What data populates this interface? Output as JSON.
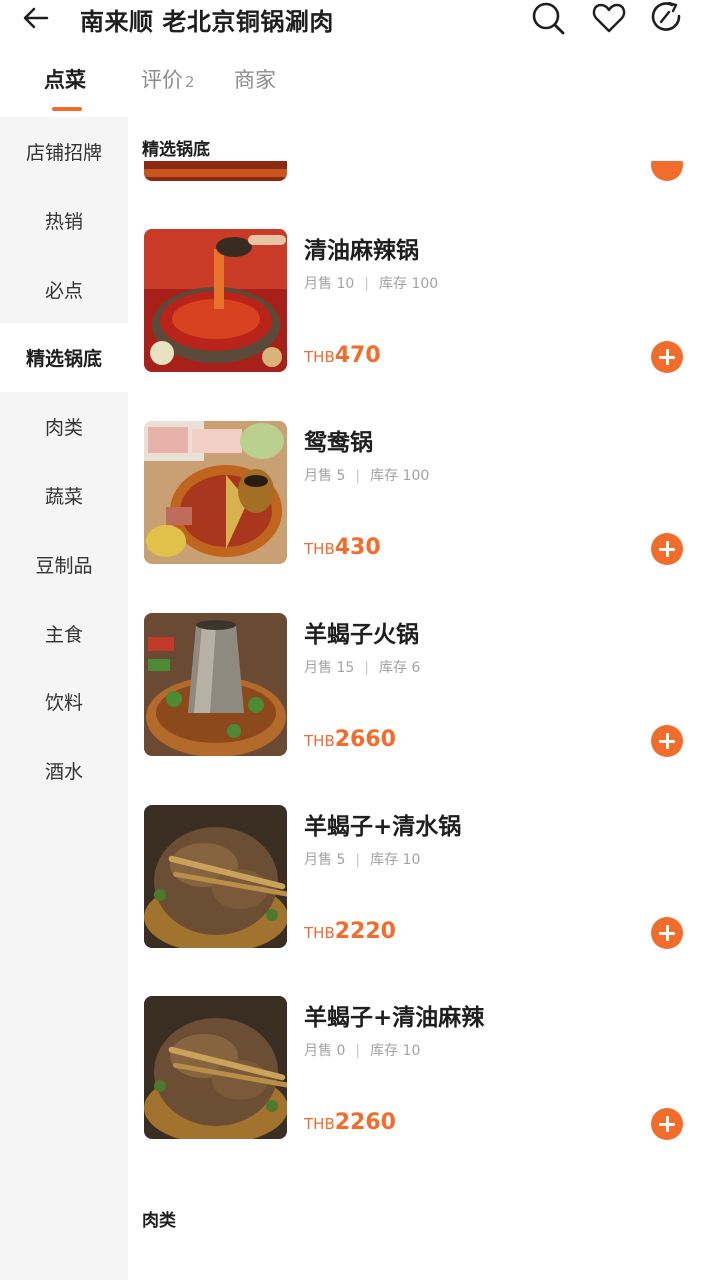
{
  "header": {
    "title": "南来顺 老北京铜锅涮肉",
    "icons": [
      "back-arrow-icon",
      "search-icon",
      "heart-icon",
      "share-icon"
    ]
  },
  "tabs": {
    "menu": "点菜",
    "reviews": "评价",
    "reviews_count": "2",
    "merchant": "商家"
  },
  "sidebar": {
    "items": [
      {
        "label": "店铺招牌"
      },
      {
        "label": "热销"
      },
      {
        "label": "必点"
      },
      {
        "label": "精选锅底"
      },
      {
        "label": "肉类"
      },
      {
        "label": "蔬菜"
      },
      {
        "label": "豆制品"
      },
      {
        "label": "主食"
      },
      {
        "label": "饮料"
      },
      {
        "label": "酒水"
      }
    ],
    "active_index": 3
  },
  "content": {
    "section_title": "精选锅底",
    "next_section_title": "肉类",
    "products": [
      {
        "name": "清油麻辣锅",
        "sales_label": "月售",
        "sales": "10",
        "stock_label": "库存",
        "stock": "100",
        "currency": "THB",
        "price": "470"
      },
      {
        "name": "鸳鸯锅",
        "sales_label": "月售",
        "sales": "5",
        "stock_label": "库存",
        "stock": "100",
        "currency": "THB",
        "price": "430"
      },
      {
        "name": "羊蝎子火锅",
        "sales_label": "月售",
        "sales": "15",
        "stock_label": "库存",
        "stock": "6",
        "currency": "THB",
        "price": "2660"
      },
      {
        "name": "羊蝎子+清水锅",
        "sales_label": "月售",
        "sales": "5",
        "stock_label": "库存",
        "stock": "10",
        "currency": "THB",
        "price": "2220"
      },
      {
        "name": "羊蝎子+清油麻辣",
        "sales_label": "月售",
        "sales": "0",
        "stock_label": "库存",
        "stock": "10",
        "currency": "THB",
        "price": "2260"
      }
    ]
  },
  "colors": {
    "accent": "#f26c2c",
    "sidebar_bg": "#f5f5f5"
  }
}
